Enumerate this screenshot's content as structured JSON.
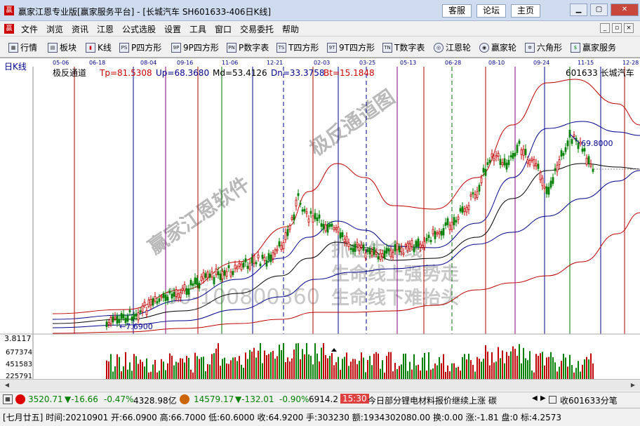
{
  "window": {
    "logo": "赢",
    "title": "赢家江恩专业版[赢家服务平台] - [长城汽车  SH601633-406日K线]",
    "top_buttons": [
      "客服",
      "论坛",
      "主页"
    ]
  },
  "menu": {
    "items": [
      "文件",
      "浏览",
      "资讯",
      "江恩",
      "公式选股",
      "设置",
      "工具",
      "窗口",
      "交易委托",
      "帮助"
    ]
  },
  "toolbar": {
    "items": [
      {
        "label": "行情",
        "icon": "quote-grid-icon",
        "glyph": "▦"
      },
      {
        "label": "板块",
        "icon": "sector-icon",
        "glyph": "▤"
      },
      {
        "label": "K线",
        "icon": "kline-icon",
        "glyph": "▮"
      },
      {
        "label": "P四方形",
        "icon": "p-square-icon",
        "glyph": "PS"
      },
      {
        "label": "9P四方形",
        "icon": "9p-square-icon",
        "glyph": "9P"
      },
      {
        "label": "P数字表",
        "icon": "p-number-icon",
        "glyph": "PN"
      },
      {
        "label": "T四方形",
        "icon": "t-square-icon",
        "glyph": "TS"
      },
      {
        "label": "9T四方形",
        "icon": "9t-square-icon",
        "glyph": "9T"
      },
      {
        "label": "T数字表",
        "icon": "t-number-icon",
        "glyph": "TN"
      },
      {
        "label": "江恩轮",
        "icon": "gann-wheel-icon",
        "glyph": "◎"
      },
      {
        "label": "赢家轮",
        "icon": "winner-wheel-icon",
        "glyph": "◉"
      },
      {
        "label": "六角形",
        "icon": "hexagon-icon",
        "glyph": "✲"
      },
      {
        "label": "赢家服务",
        "icon": "dollar-icon",
        "glyph": "$"
      }
    ]
  },
  "chart": {
    "period_label": "日K线",
    "indicator_name": "极反通道",
    "params": {
      "tp": "Tp=81.5308",
      "up": "Up=68.3680",
      "md": "Md=53.4126",
      "dn": "Dn=33.3758",
      "bt": "Bt=15.1848"
    },
    "stock": "601633  长城汽车",
    "date_ticks": [
      "05-06",
      "06-18",
      "08-04",
      "09-16",
      "11-06",
      "12-21",
      "02-03",
      "03-25",
      "05-13",
      "06-28",
      "08-10",
      "09-24",
      "11-15",
      "12-28"
    ],
    "price_low_label": "3.8117",
    "low_annotation": "7.6900",
    "high_annotation": "69.8000",
    "volume_ticks": [
      "677374",
      "451583",
      "225791"
    ],
    "watermarks": {
      "software": "赢家江恩软件",
      "diagram": "极反通道图",
      "phone": "00-100800360",
      "slogan1": "抓住生命线",
      "slogan2": "生命线上强势走",
      "slogan3": "生命线下难抬头"
    },
    "colors": {
      "candle_up": "#c00000",
      "candle_down": "#008000",
      "channel_outer": "#c00000",
      "channel_inner": "#00008b",
      "mid_line": "#000000",
      "vline_red": "#b00000",
      "vline_blue": "#00008b",
      "vline_green": "#007000",
      "vline_purple": "#800080"
    }
  },
  "status": {
    "sh_index": "3520.71",
    "sh_change": "▼-16.66",
    "sh_pct": "-0.47%",
    "sh_amount": "4328.98亿",
    "sz_index": "14579.17",
    "sz_change": "▼-132.01",
    "sz_pct": "-0.90%",
    "sz_amount": "6914.2",
    "news_time": "15:30",
    "news_text": "今日部分锂电材料报价继续上涨 碳",
    "news_right": "收601633分笔"
  },
  "info": {
    "text": "[七月廿五] 时间:20210901 开:66.0900 高:66.7000 低:60.6000 收:64.9200 手:303230 额:1934302080.00 换:0.00 涨:-1.81 盘:0 标:4.2573"
  }
}
